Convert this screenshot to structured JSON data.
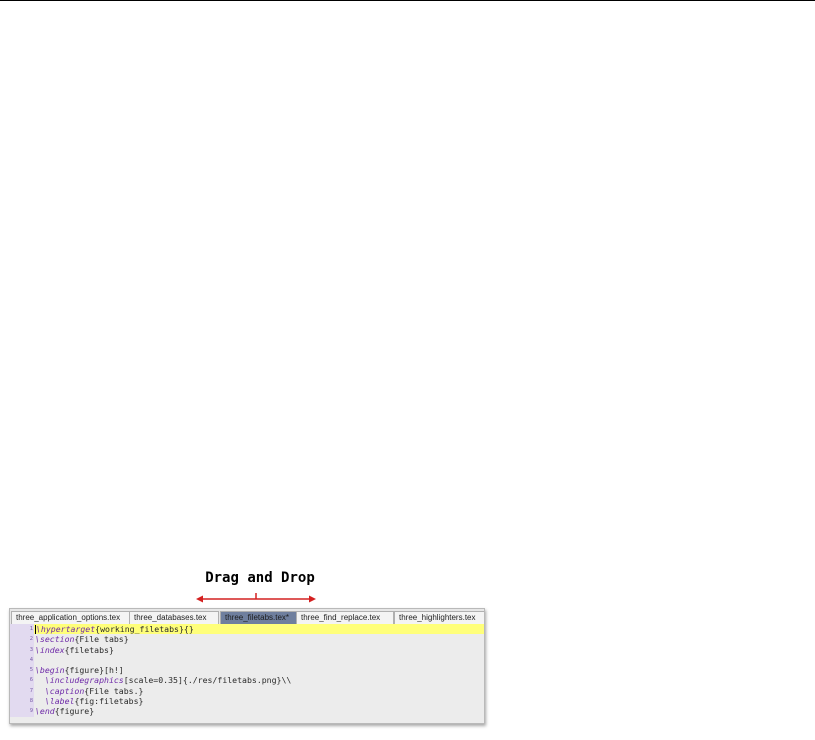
{
  "annotation": {
    "title": "Drag and Drop"
  },
  "tabs": [
    {
      "label": "three_application_options.tex",
      "active": false
    },
    {
      "label": "three_databases.tex",
      "active": false
    },
    {
      "label": "three_filetabs.tex*",
      "active": true
    },
    {
      "label": "three_find_replace.tex",
      "active": false
    },
    {
      "label": "three_highlighters.tex",
      "active": false
    }
  ],
  "editor": {
    "lines": [
      {
        "num": "1",
        "cmd": "\\hypertarget",
        "rest": "{working_filetabs}{}",
        "indent": "",
        "current": true
      },
      {
        "num": "2",
        "cmd": "\\section",
        "rest": "{File tabs}",
        "indent": ""
      },
      {
        "num": "3",
        "cmd": "\\index",
        "rest": "{filetabs}",
        "indent": ""
      },
      {
        "num": "4",
        "cmd": "",
        "rest": "",
        "indent": ""
      },
      {
        "num": "5",
        "cmd": "\\begin",
        "rest": "{figure}[h!]",
        "indent": ""
      },
      {
        "num": "6",
        "cmd": "\\includegraphics",
        "rest": "[scale=0.35]{./res/filetabs.png}\\\\",
        "indent": "  "
      },
      {
        "num": "7",
        "cmd": "\\caption",
        "rest": "{File tabs.}",
        "indent": "  "
      },
      {
        "num": "8",
        "cmd": "\\label",
        "rest": "{fig:filetabs}",
        "indent": "  "
      },
      {
        "num": "9",
        "cmd": "\\end",
        "rest": "{figure}",
        "indent": ""
      }
    ]
  },
  "colors": {
    "arrow": "#d42020",
    "current_line": "#ffff7a",
    "gutter": "#e2daf0",
    "command": "#6e2aa8",
    "active_tab": "#6f7f9e"
  }
}
